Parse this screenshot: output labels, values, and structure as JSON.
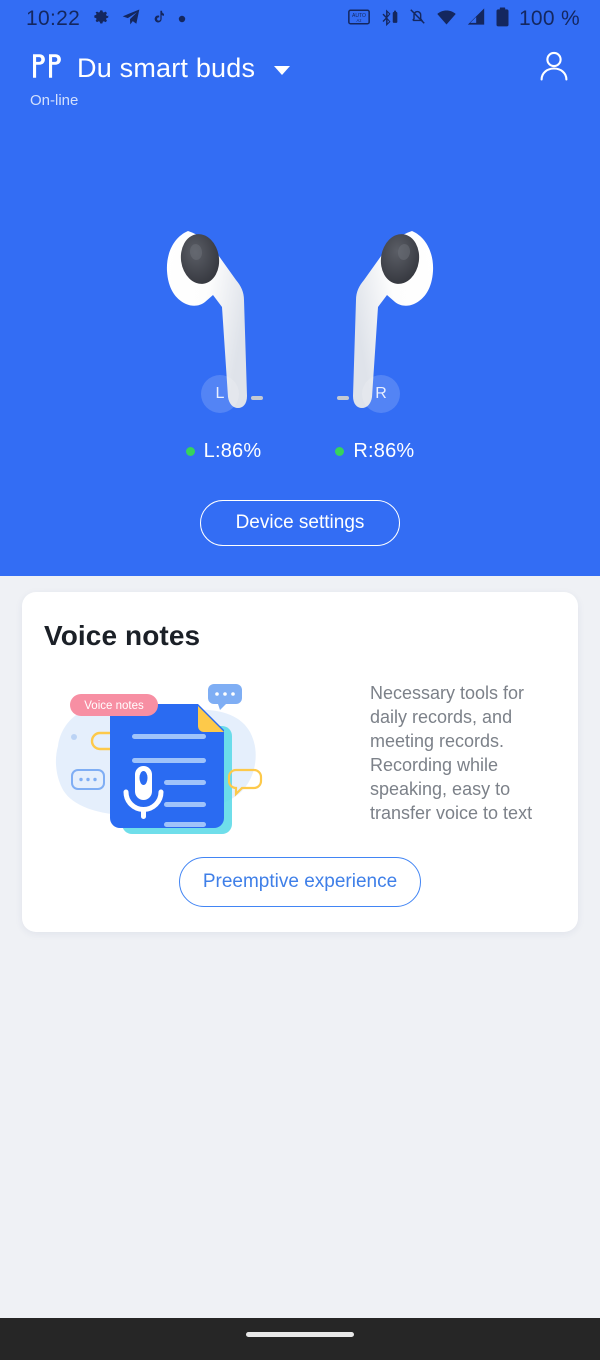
{
  "statusbar": {
    "time": "10:22",
    "left_icons": [
      "settings-gear-icon",
      "telegram-icon",
      "tiktok-icon",
      "dot-icon"
    ],
    "right_icons": [
      "auto-rotate-icon",
      "bluetooth-battery-icon",
      "notifications-muted-icon",
      "wifi-icon",
      "cellular-signal-icon",
      "battery-icon"
    ],
    "battery_percent": "100 %"
  },
  "header": {
    "logo_icon": "earbuds-logo-icon",
    "title": "Du smart buds",
    "dropdown_icon": "chevron-down-icon",
    "account_icon": "account-person-icon",
    "status": "On-line",
    "accent_color": "#336DF4"
  },
  "device": {
    "left_badge": "L",
    "right_badge": "R",
    "left_battery": "L:86%",
    "right_battery": "R:86%",
    "battery_dot_color": "#36D35C",
    "settings_button": "Device settings"
  },
  "card": {
    "title": "Voice notes",
    "description": "Necessary tools for daily records, and meeting records. Recording while speaking, easy to transfer voice to text",
    "illustration": {
      "tag_label": "Voice notes",
      "tag_color": "#F78FA3",
      "doc_color": "#2A6BF2",
      "mic_icon": "microphone-icon",
      "corner_color": "#FDC94A",
      "bubble_icon": "chat-bubble-icon"
    },
    "cta_button": "Preemptive experience",
    "cta_color": "#3F7FE8"
  },
  "navbar": {
    "home_indicator": "home-indicator"
  }
}
